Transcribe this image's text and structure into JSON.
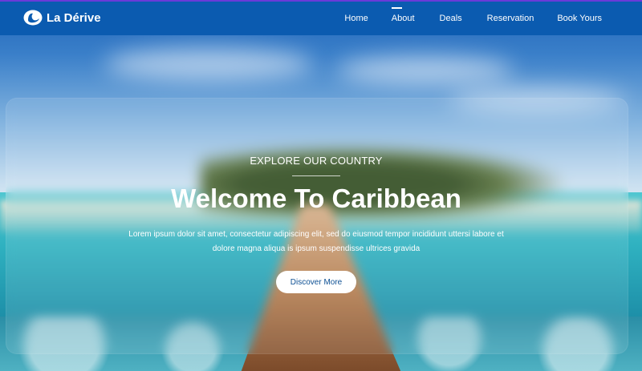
{
  "brand": {
    "name": "La Dérive",
    "icon": "wave-logo-icon"
  },
  "nav": {
    "items": [
      {
        "label": "Home",
        "active": false
      },
      {
        "label": "About",
        "active": true
      },
      {
        "label": "Deals",
        "active": false
      },
      {
        "label": "Reservation",
        "active": false
      },
      {
        "label": "Book Yours",
        "active": false
      }
    ]
  },
  "hero": {
    "eyebrow": "EXPLORE OUR COUNTRY",
    "title": "Welcome To Caribbean",
    "description_line1": "Lorem ipsum dolor sit amet, consectetur adipiscing elit, sed do eiusmod tempor incididunt uttersi labore et",
    "description_line2": "dolore magna aliqua is ipsum suspendisse ultrices gravida",
    "cta_label": "Discover More"
  },
  "colors": {
    "nav_bg": "#0b5bb0",
    "accent_top": "#6b3bd8",
    "cta_text": "#0c4f93",
    "text": "#ffffff"
  }
}
